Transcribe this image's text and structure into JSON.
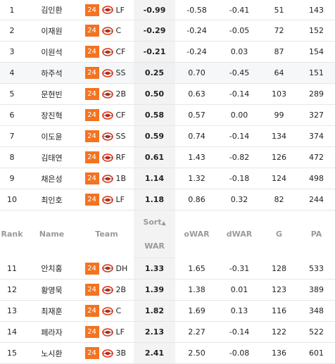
{
  "colors": {
    "team_badge": "#f37321",
    "logo_red": "#d9361c"
  },
  "header": {
    "rank": "Rank",
    "name": "Name",
    "team": "Team",
    "sort": "Sort",
    "sort_arrow": "▲",
    "war": "WAR",
    "owar": "oWAR",
    "dwar": "dWAR",
    "g": "G",
    "pa": "PA"
  },
  "rows": [
    {
      "rank": "1",
      "name": "김인환",
      "team": "24",
      "pos": "LF",
      "war": "-0.99",
      "owar": "-0.58",
      "dwar": "-0.41",
      "g": "51",
      "pa": "143"
    },
    {
      "rank": "2",
      "name": "이재원",
      "team": "24",
      "pos": "C",
      "war": "-0.29",
      "owar": "-0.24",
      "dwar": "-0.05",
      "g": "72",
      "pa": "152"
    },
    {
      "rank": "3",
      "name": "이원석",
      "team": "24",
      "pos": "CF",
      "war": "-0.21",
      "owar": "-0.24",
      "dwar": "0.03",
      "g": "87",
      "pa": "154"
    },
    {
      "rank": "4",
      "name": "하주석",
      "team": "24",
      "pos": "SS",
      "war": "0.25",
      "owar": "0.70",
      "dwar": "-0.45",
      "g": "64",
      "pa": "151"
    },
    {
      "rank": "5",
      "name": "문현빈",
      "team": "24",
      "pos": "2B",
      "war": "0.50",
      "owar": "0.63",
      "dwar": "-0.14",
      "g": "103",
      "pa": "289"
    },
    {
      "rank": "6",
      "name": "장진혁",
      "team": "24",
      "pos": "CF",
      "war": "0.58",
      "owar": "0.57",
      "dwar": "0.00",
      "g": "99",
      "pa": "327"
    },
    {
      "rank": "7",
      "name": "이도윤",
      "team": "24",
      "pos": "SS",
      "war": "0.59",
      "owar": "0.74",
      "dwar": "-0.14",
      "g": "134",
      "pa": "374"
    },
    {
      "rank": "8",
      "name": "김태연",
      "team": "24",
      "pos": "RF",
      "war": "0.61",
      "owar": "1.43",
      "dwar": "-0.82",
      "g": "126",
      "pa": "472"
    },
    {
      "rank": "9",
      "name": "채은성",
      "team": "24",
      "pos": "1B",
      "war": "1.14",
      "owar": "1.32",
      "dwar": "-0.18",
      "g": "124",
      "pa": "498"
    },
    {
      "rank": "10",
      "name": "최인호",
      "team": "24",
      "pos": "LF",
      "war": "1.18",
      "owar": "0.86",
      "dwar": "0.32",
      "g": "82",
      "pa": "244"
    },
    {
      "rank": "11",
      "name": "안치홍",
      "team": "24",
      "pos": "DH",
      "war": "1.33",
      "owar": "1.65",
      "dwar": "-0.31",
      "g": "128",
      "pa": "533"
    },
    {
      "rank": "12",
      "name": "황영묵",
      "team": "24",
      "pos": "2B",
      "war": "1.39",
      "owar": "1.38",
      "dwar": "0.01",
      "g": "123",
      "pa": "389"
    },
    {
      "rank": "13",
      "name": "최재훈",
      "team": "24",
      "pos": "C",
      "war": "1.82",
      "owar": "1.69",
      "dwar": "0.13",
      "g": "116",
      "pa": "348"
    },
    {
      "rank": "14",
      "name": "페라자",
      "team": "24",
      "pos": "LF",
      "war": "2.13",
      "owar": "2.27",
      "dwar": "-0.14",
      "g": "122",
      "pa": "522"
    },
    {
      "rank": "15",
      "name": "노시환",
      "team": "24",
      "pos": "3B",
      "war": "2.41",
      "owar": "2.50",
      "dwar": "-0.08",
      "g": "136",
      "pa": "601"
    }
  ]
}
